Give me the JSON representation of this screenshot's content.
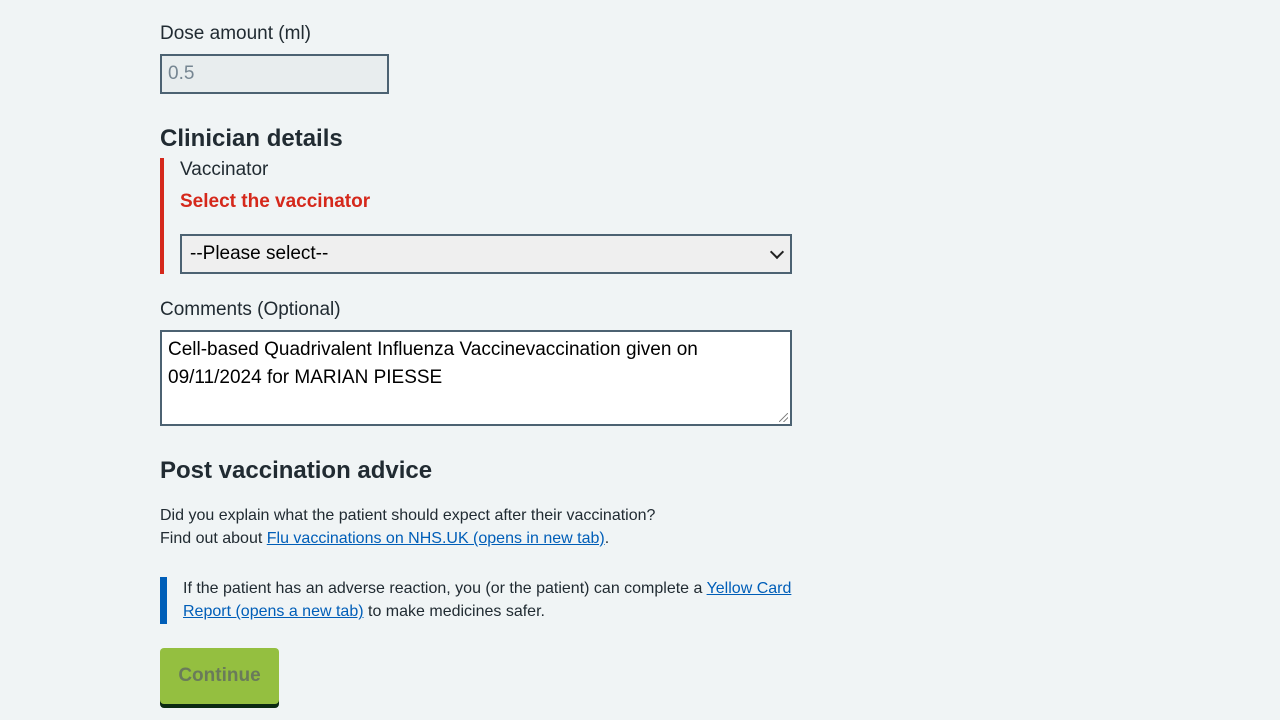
{
  "dose": {
    "label": "Dose amount (ml)",
    "value": "0.5"
  },
  "clinician": {
    "heading": "Clinician details",
    "vaccinator_label": "Vaccinator",
    "error_message": "Select the vaccinator",
    "select_value": "--Please select--"
  },
  "comments": {
    "label": "Comments (Optional)",
    "value": "Cell-based Quadrivalent Influenza Vaccinevaccination given on 09/11/2024 for MARIAN PIESSE"
  },
  "advice": {
    "heading": "Post vaccination advice",
    "question": "Did you explain what the patient should expect after their vaccination?",
    "find_out_prefix": "Find out about ",
    "find_out_link": "Flu vaccinations on NHS.UK (opens in new tab)",
    "find_out_suffix": ".",
    "inset_prefix": "If the patient has an adverse reaction, you (or the patient) can complete a ",
    "inset_link": "Yellow Card Report (opens a new tab)",
    "inset_suffix": " to make medicines safer."
  },
  "continue_label": "Continue",
  "colors": {
    "error": "#d5281b",
    "link": "#005eb8",
    "button": "#94bf40",
    "background": "#f0f4f5"
  }
}
